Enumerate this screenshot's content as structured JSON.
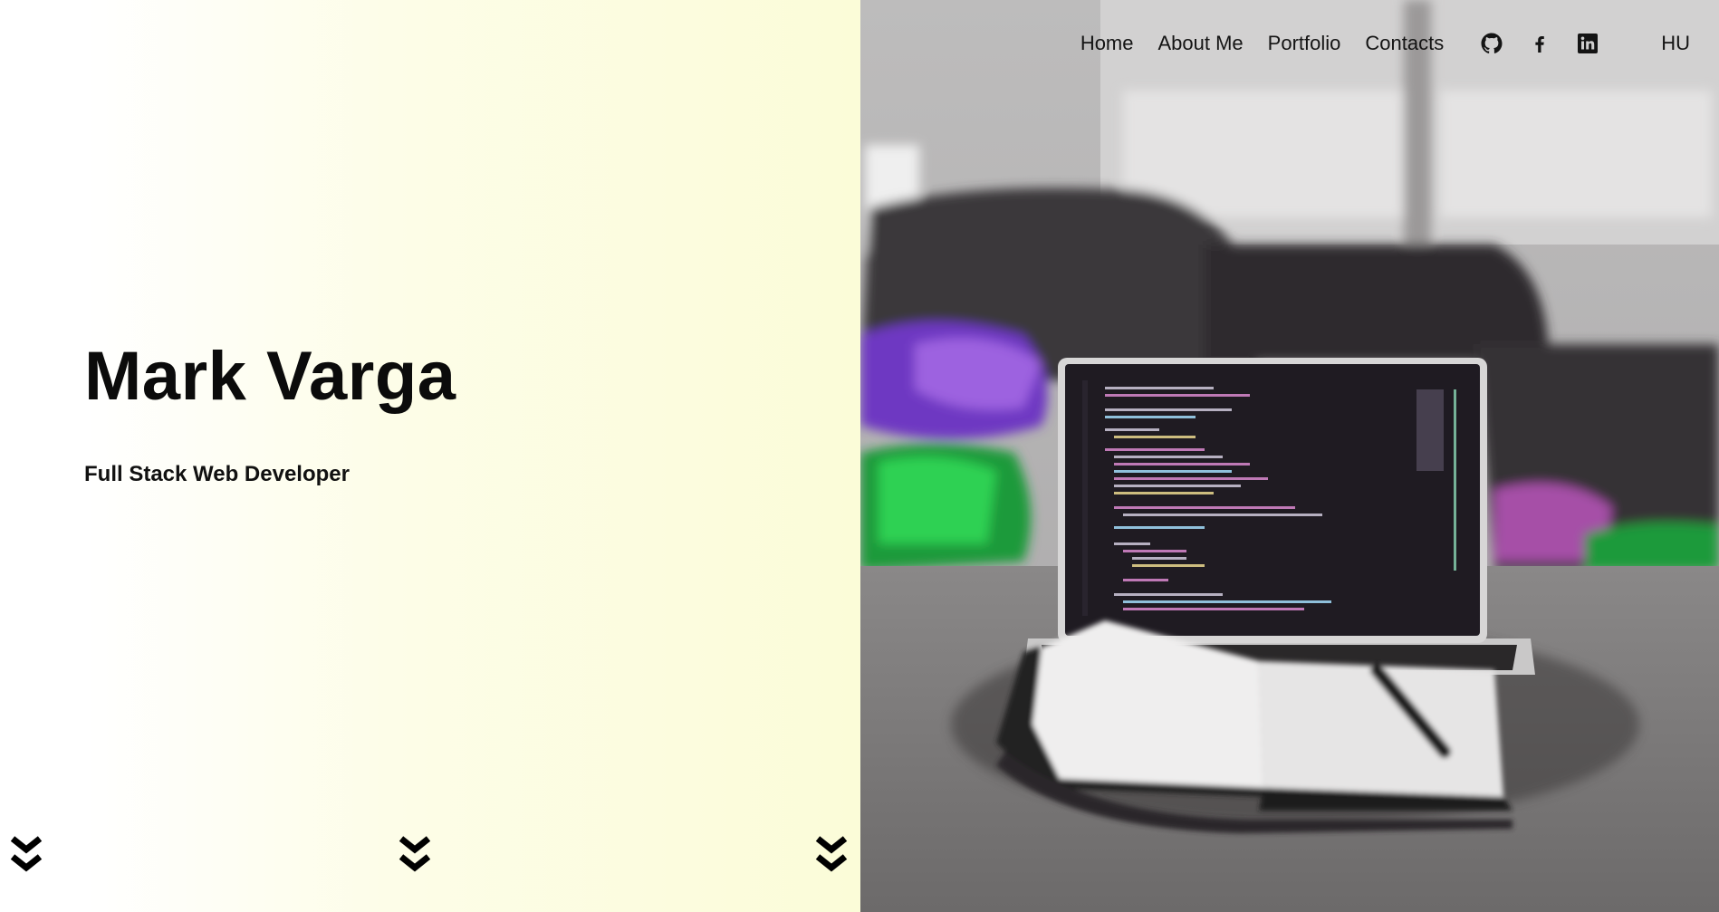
{
  "hero": {
    "name": "Mark Varga",
    "role": "Full Stack Web Developer"
  },
  "nav": {
    "links": [
      "Home",
      "About Me",
      "Portfolio",
      "Contacts"
    ],
    "social_icons": [
      "github-icon",
      "facebook-icon",
      "linkedin-icon"
    ],
    "language": "HU"
  },
  "scroll_icons": [
    "double-chevron-down-icon",
    "double-chevron-down-icon",
    "double-chevron-down-icon"
  ],
  "colors": {
    "left_gradient_start": "#ffffff",
    "left_gradient_end": "#fbfcd8",
    "text": "#0b0b0b"
  }
}
